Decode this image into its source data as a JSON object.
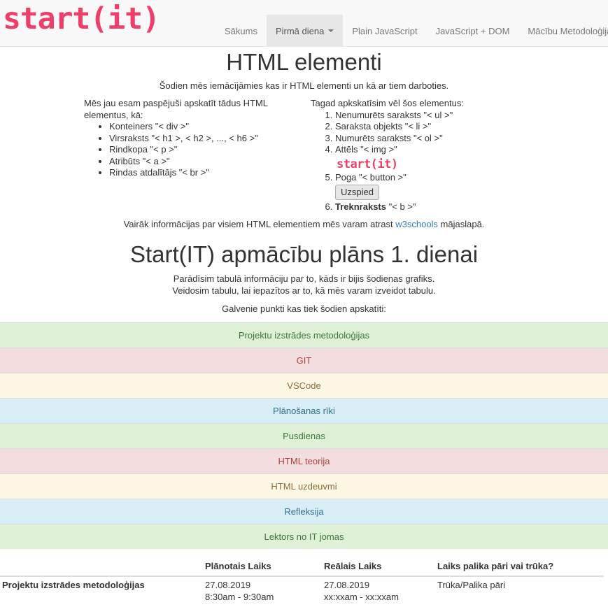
{
  "navbar": {
    "brand": "start(it)",
    "items": [
      {
        "label": "Sākums"
      },
      {
        "label": "Pirmā diena"
      },
      {
        "label": "Plain JavaScript"
      },
      {
        "label": "JavaScript + DOM"
      },
      {
        "label": "Mācību Metodoloģija"
      }
    ]
  },
  "section1": {
    "title": "HTML elementi",
    "intro": "Šodien mēs iemācījāmies kas ir HTML elementi un kā ar tiem darboties.",
    "left": {
      "lead": "Mēs jau esam paspējuši apskatīt tādus HTML elementus, kā:",
      "items": [
        "Konteiners \"< div >\"",
        "Virsraksts \"< h1 >, < h2 >, ..., < h6 >\"",
        "Rindkopa \"< p >\"",
        "Atribūts \"< a >\"",
        "Rindas atdalītājs \"< br >\""
      ]
    },
    "right": {
      "lead": "Tagad apkskatīsim vēl šos elementus:",
      "items": [
        "Nenumurēts saraksts \"< ul >\"",
        "Saraksta objekts \"< li >\"",
        "Numurēts saraksts \"< ol >\"",
        "Attēls \"< img >\"",
        "Poga \"< button >\"",
        "\"< b >\""
      ],
      "img_logo": "start(it)",
      "button_label": "Uzspied",
      "bold_word": "Treknraksts"
    },
    "more_prefix": "Vairāk informācijas par visiem HTML elementiem mēs varam atrast ",
    "more_link": "w3schools",
    "more_suffix": " mājaslapā."
  },
  "section2": {
    "title": "Start(IT) apmācību plāns 1. dienai",
    "line1": "Parādīsim tabulā informāciju par to, kāds ir bijis šodienas grafiks.",
    "line2": "Veidosim tabulu, lai iepazītos ar to, kā mēs varam izveidot tabulu.",
    "points_lead": "Galvenie punkti kas tiek šodien apskatīti:",
    "points": [
      {
        "label": "Projektu izstrādes metodoloģijas",
        "color": "#dff0d8"
      },
      {
        "label": "GIT",
        "color": "#f2dede"
      },
      {
        "label": "VSCode",
        "color": "#fcf8e3"
      },
      {
        "label": "Plānošanas rīki",
        "color": "#d9edf7"
      },
      {
        "label": "Pusdienas",
        "color": "#dff0d8"
      },
      {
        "label": "HTML teorija",
        "color": "#f2dede"
      },
      {
        "label": "HTML uzdeuvmi",
        "color": "#fcf8e3"
      },
      {
        "label": "Refleksija",
        "color": "#d9edf7"
      },
      {
        "label": "Lektors no IT jomas",
        "color": "#dff0d8"
      }
    ]
  },
  "table": {
    "headers": [
      "",
      "Plānotais Laiks",
      "Reālais Laiks",
      "Laiks palika pāri vai trūka?"
    ],
    "rows": [
      {
        "name": "Projektu izstrādes metodoloģijas",
        "planned_date": "27.08.2019",
        "planned_time": "8:30am - 9:30am",
        "actual_date": "27.08.2019",
        "actual_time": "xx:xxam - xx:xxam",
        "status": "Trūka/Palika pāri"
      }
    ]
  },
  "colors": {
    "brand": "#ee3f6a",
    "link": "#337ab7"
  }
}
